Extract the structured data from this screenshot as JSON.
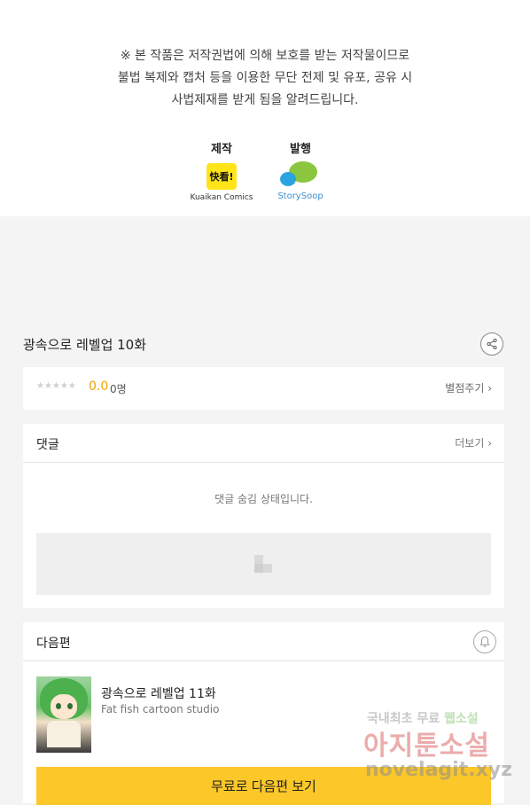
{
  "notice": {
    "line1": "※ 본 작품은 저작권법에 의해 보호를 받는 저작물이므로",
    "line2": "불법 복제와 캡처 등을  이용한 무단 전제 및 유포, 공유 시",
    "line3": "사법제재를  받게 됨을 알려드립니다."
  },
  "credits": {
    "producer_label": "제작",
    "producer_logo": "快看!",
    "producer_name": "Kuaikan Comics",
    "publisher_label": "발행",
    "publisher_name": "StorySoop"
  },
  "episode": {
    "title": "광속으로 레벨업 10화"
  },
  "rating": {
    "stars": "★★★★★",
    "score": "0.0",
    "count": "0명",
    "rate_link": "별점주기 ›"
  },
  "comments": {
    "title": "댓글",
    "more": "더보기 ›",
    "hidden_message": "댓글 숨김 상태입니다."
  },
  "next_episode": {
    "section_title": "다음편",
    "title": "광속으로 레벨업 11화",
    "studio": "Fat fish cartoon studio",
    "button_label": "무료로 다음편 보기"
  },
  "watermark": {
    "line1_a": "국내최초 무료",
    "line1_b": "웹소설",
    "line2": "아지툰소설",
    "url": "novelagit.xyz"
  },
  "colors": {
    "accent": "#fcc728",
    "score": "#f0a500"
  }
}
